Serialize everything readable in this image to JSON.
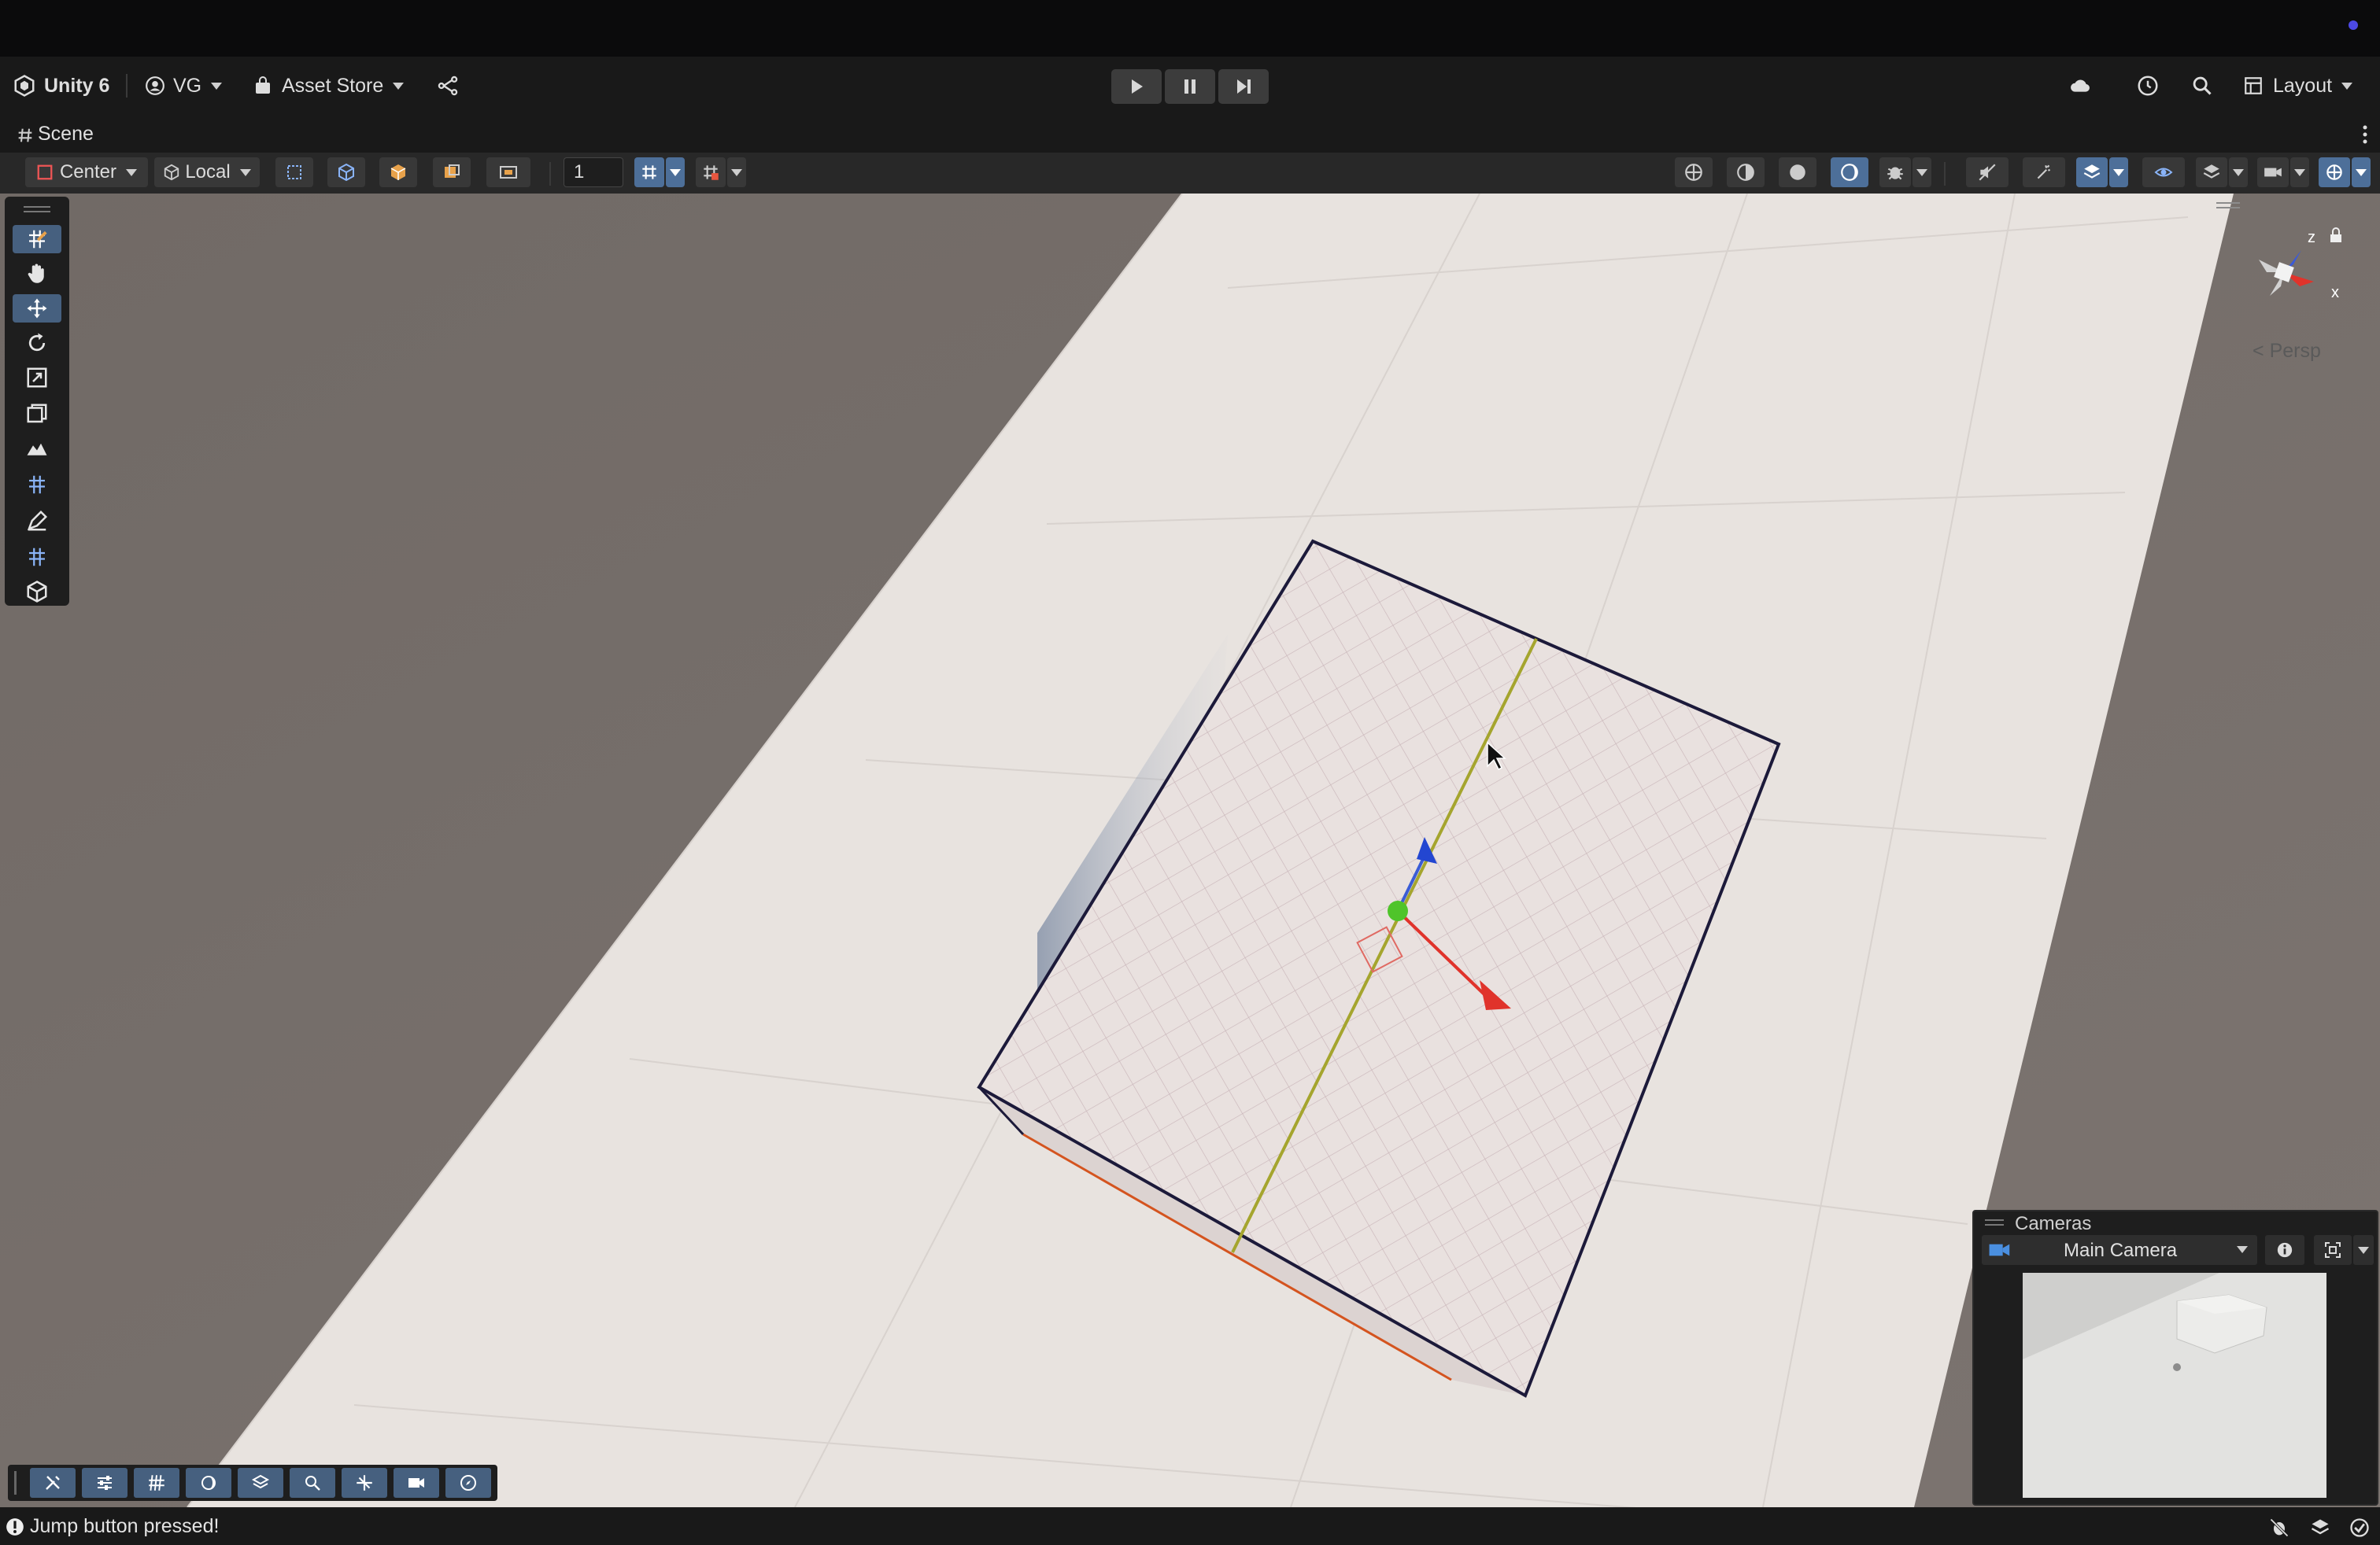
{
  "app": {
    "title": "Unity 6"
  },
  "mainbar": {
    "account_label": "VG",
    "asset_store_label": "Asset Store",
    "layout_label": "Layout"
  },
  "scene_tab": {
    "label": "Scene"
  },
  "scene_toolbar": {
    "pivot_label": "Center",
    "space_label": "Local",
    "grid_size_value": "1"
  },
  "viewport": {
    "projection_label": "Persp",
    "axis_z": "z",
    "axis_x": "x"
  },
  "cameras_overlay": {
    "title": "Cameras",
    "selected_camera": "Main Camera"
  },
  "status": {
    "message": "Jump button pressed!"
  },
  "colors": {
    "accent": "#46607f",
    "selection_outline": "#1c1a3a",
    "axis_x": "#e0332b",
    "axis_y": "#4fc42a",
    "axis_z": "#2346d1",
    "grid_line": "#a5a52e"
  },
  "icons": [
    "unity-logo-icon",
    "account-icon",
    "asset-store-icon",
    "version-control-icon",
    "play-icon",
    "pause-icon",
    "step-icon",
    "cloud-icon",
    "history-icon",
    "search-icon",
    "layout-icon",
    "hand-tool-icon",
    "move-tool-icon",
    "rotate-tool-icon",
    "scale-tool-icon",
    "rect-tool-icon",
    "camera-icon",
    "info-icon",
    "warning-icon"
  ]
}
